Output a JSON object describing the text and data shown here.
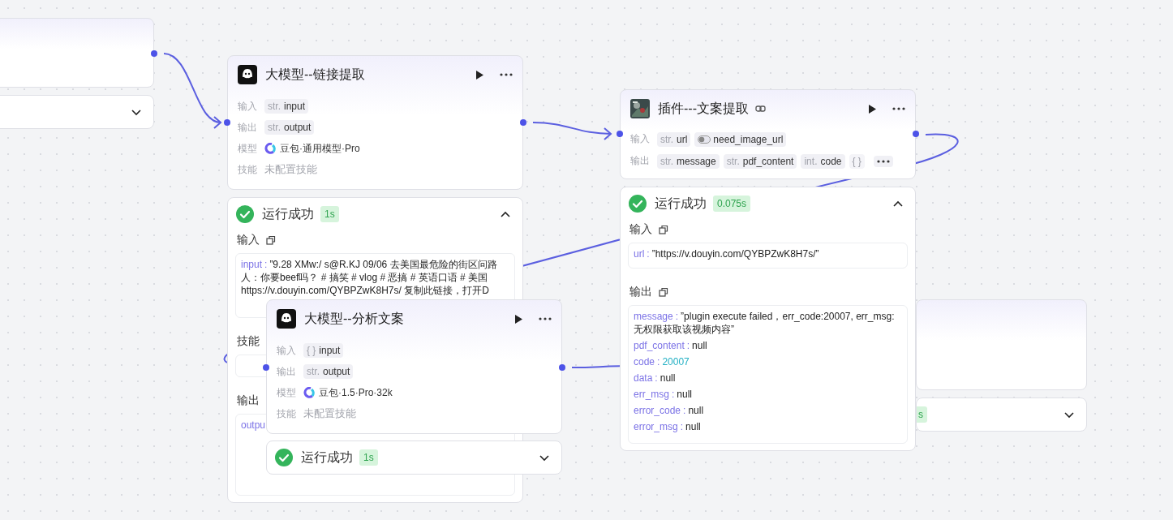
{
  "left_node": {
    "result": {
      "expanded": false
    }
  },
  "nodes": [
    {
      "kind": "llm",
      "title": "大模型--链接提取",
      "rows": [
        {
          "label": "输入",
          "kind": "params",
          "params": [
            {
              "kind": "typed",
              "type": "str.",
              "name": "input"
            }
          ]
        },
        {
          "label": "输出",
          "kind": "params",
          "params": [
            {
              "kind": "typed",
              "type": "str.",
              "name": "output"
            }
          ]
        },
        {
          "label": "模型",
          "kind": "model",
          "value": "豆包·通用模型·Pro"
        },
        {
          "label": "技能",
          "kind": "note",
          "value": "未配置技能"
        }
      ],
      "result": {
        "status": "运行成功",
        "time": "1s",
        "expanded": true,
        "sections": [
          {
            "kind": "io",
            "title": "输入",
            "copy": true,
            "entries": [
              {
                "key": "input",
                "sep": ":",
                "value": "”9.28 XMw:/ s@R.KJ 09/06 去美国最危险的街区问路人：你要beef吗？ # 搞笑 # vlog # 恶搞 # 英语口语 # 美国  https://v.douyin.com/QYBPZwK8H7s/ 复制此链接，打开D",
                "kind": "string"
              }
            ]
          },
          {
            "kind": "box",
            "title": "技能"
          },
          {
            "kind": "io",
            "title": "输出",
            "copy": false,
            "entries": [
              {
                "key": "outpu"
              }
            ]
          }
        ]
      }
    },
    {
      "kind": "plugin",
      "title": "插件---文案提取",
      "rows": [
        {
          "label": "输入",
          "kind": "params",
          "params": [
            {
              "kind": "typed",
              "type": "str.",
              "name": "url"
            },
            {
              "kind": "bool",
              "name": "need_image_url"
            }
          ]
        },
        {
          "label": "输出",
          "kind": "params",
          "params": [
            {
              "kind": "typed",
              "type": "str.",
              "name": "message"
            },
            {
              "kind": "typed",
              "type": "str.",
              "name": "pdf_content"
            },
            {
              "kind": "typed",
              "type": "int.",
              "name": "code"
            },
            {
              "kind": "faded",
              "type": "{ }"
            },
            {
              "kind": "more"
            }
          ]
        }
      ],
      "result": {
        "status": "运行成功",
        "time": "0.075s",
        "expanded": true,
        "sections": [
          {
            "kind": "io",
            "title": "输入",
            "copy": true,
            "entries": [
              {
                "key": "url",
                "sep": ":",
                "value": "”https://v.douyin.com/QYBPZwK8H7s/”",
                "kind": "string"
              }
            ]
          },
          {
            "kind": "io",
            "title": "输出",
            "copy": true,
            "entries": [
              {
                "key": "message",
                "sep": ":",
                "value": "”plugin execute failed，err_code:20007, err_msg:无权限获取该视频内容”",
                "kind": "string"
              },
              {
                "key": "pdf_content",
                "sep": ":",
                "value": "null",
                "kind": "null"
              },
              {
                "key": "code",
                "sep": ":",
                "value": "20007",
                "kind": "number"
              },
              {
                "key": "data",
                "sep": ":",
                "value": "null",
                "kind": "null"
              },
              {
                "key": "err_msg",
                "sep": ":",
                "value": "null",
                "kind": "null"
              },
              {
                "key": "error_code",
                "sep": ":",
                "value": "null",
                "kind": "null"
              },
              {
                "key": "error_msg",
                "sep": ":",
                "value": "null",
                "kind": "null"
              }
            ]
          }
        ]
      }
    },
    {
      "kind": "llm",
      "title": "大模型--分析文案",
      "rows": [
        {
          "label": "输入",
          "kind": "params",
          "params": [
            {
              "kind": "typed",
              "type": "{ }",
              "name": "input"
            }
          ]
        },
        {
          "label": "输出",
          "kind": "params",
          "params": [
            {
              "kind": "typed",
              "type": "str.",
              "name": "output"
            }
          ]
        },
        {
          "label": "模型",
          "kind": "model",
          "value": "豆包·1.5·Pro·32k"
        },
        {
          "label": "技能",
          "kind": "note",
          "value": "未配置技能"
        }
      ],
      "result": {
        "status": "运行成功",
        "time": "1s",
        "expanded": false
      }
    }
  ],
  "right_node": {
    "result": {
      "time": "s",
      "expanded": false
    }
  }
}
